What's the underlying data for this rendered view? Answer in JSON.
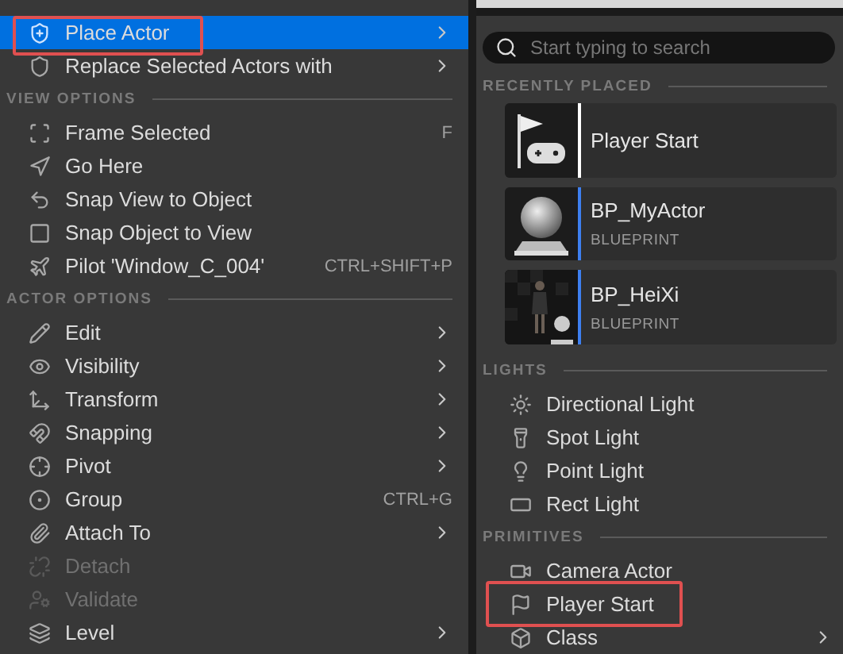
{
  "context_menu": {
    "items": [
      {
        "kind": "item",
        "label": "Place Actor",
        "submenu": true,
        "disabled": false,
        "selected": true,
        "outlined": true
      },
      {
        "kind": "item",
        "label": "Replace Selected Actors with",
        "submenu": true,
        "disabled": false,
        "selected": false,
        "outlined": false
      },
      {
        "kind": "header",
        "label": "VIEW OPTIONS"
      },
      {
        "kind": "item",
        "label": "Frame Selected",
        "shortcut": "F",
        "submenu": false,
        "disabled": false,
        "selected": false,
        "outlined": false
      },
      {
        "kind": "item",
        "label": "Go Here",
        "submenu": false,
        "disabled": false,
        "selected": false,
        "outlined": false
      },
      {
        "kind": "item",
        "label": "Snap View to Object",
        "submenu": false,
        "disabled": false,
        "selected": false,
        "outlined": false
      },
      {
        "kind": "item",
        "label": "Snap Object to View",
        "submenu": false,
        "disabled": false,
        "selected": false,
        "outlined": false
      },
      {
        "kind": "item",
        "label": "Pilot 'Window_C_004'",
        "shortcut": "CTRL+SHIFT+P",
        "submenu": false,
        "disabled": false,
        "selected": false,
        "outlined": false
      },
      {
        "kind": "header",
        "label": "ACTOR OPTIONS"
      },
      {
        "kind": "item",
        "label": "Edit",
        "submenu": true,
        "disabled": false,
        "selected": false,
        "outlined": false
      },
      {
        "kind": "item",
        "label": "Visibility",
        "submenu": true,
        "disabled": false,
        "selected": false,
        "outlined": false
      },
      {
        "kind": "item",
        "label": "Transform",
        "submenu": true,
        "disabled": false,
        "selected": false,
        "outlined": false
      },
      {
        "kind": "item",
        "label": "Snapping",
        "submenu": true,
        "disabled": false,
        "selected": false,
        "outlined": false
      },
      {
        "kind": "item",
        "label": "Pivot",
        "submenu": true,
        "disabled": false,
        "selected": false,
        "outlined": false
      },
      {
        "kind": "item",
        "label": "Group",
        "shortcut": "CTRL+G",
        "submenu": false,
        "disabled": false,
        "selected": false,
        "outlined": false
      },
      {
        "kind": "item",
        "label": "Attach To",
        "submenu": true,
        "disabled": false,
        "selected": false,
        "outlined": false
      },
      {
        "kind": "item",
        "label": "Detach",
        "submenu": false,
        "disabled": true,
        "selected": false,
        "outlined": false
      },
      {
        "kind": "item",
        "label": "Validate",
        "submenu": false,
        "disabled": true,
        "selected": false,
        "outlined": false
      },
      {
        "kind": "item",
        "label": "Level",
        "submenu": true,
        "disabled": false,
        "selected": false,
        "outlined": false
      }
    ]
  },
  "place_actor_panel": {
    "search": {
      "placeholder": "Start typing to search"
    },
    "recently_placed": {
      "title": "RECENTLY PLACED",
      "items": [
        {
          "name": "Player Start",
          "color": "#ffffff"
        },
        {
          "name": "BP_MyActor",
          "type": "BLUEPRINT",
          "color": "#3d7ff0"
        },
        {
          "name": "BP_HeiXi",
          "type": "BLUEPRINT",
          "color": "#3d7ff0"
        }
      ]
    },
    "sections": [
      {
        "title": "LIGHTS",
        "items": [
          {
            "label": "Directional Light",
            "submenu": false,
            "outlined": false
          },
          {
            "label": "Spot Light",
            "submenu": false,
            "outlined": false
          },
          {
            "label": "Point Light",
            "submenu": false,
            "outlined": false
          },
          {
            "label": "Rect Light",
            "submenu": false,
            "outlined": false
          }
        ]
      },
      {
        "title": "PRIMITIVES",
        "items": [
          {
            "label": "Camera Actor",
            "submenu": false,
            "outlined": false
          },
          {
            "label": "Player Start",
            "submenu": false,
            "outlined": true
          },
          {
            "label": "Class",
            "submenu": true,
            "outlined": false
          }
        ]
      }
    ]
  }
}
